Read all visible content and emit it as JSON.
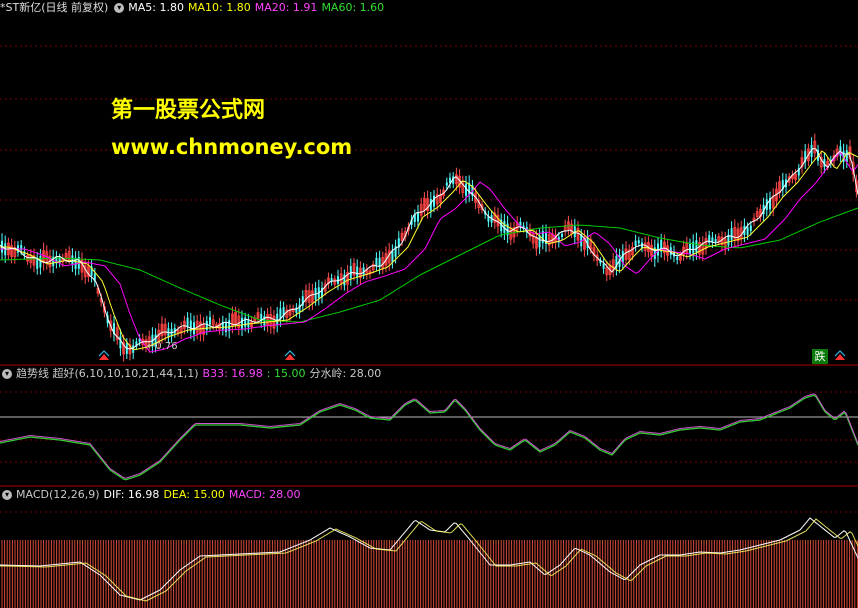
{
  "main_header": {
    "title": "*ST新亿(日线 前复权)",
    "ma5": "MA5: 1.80",
    "ma10": "MA10: 1.80",
    "ma20": "MA20: 1.91",
    "ma60": "MA60: 1.60"
  },
  "watermark": {
    "line1": "第一股票公式网",
    "line2": "www.chnmoney.com"
  },
  "low_price_label": "←0.76",
  "signal_badge": "跌",
  "trend_header": {
    "name": "趋势线 超好(6,10,10,10,21,44,1,1)",
    "b33": "B33: 16.98",
    "v2": ": 15.00",
    "fsl": "分水岭: 28.00"
  },
  "macd_header": {
    "name": "MACD(12,26,9)",
    "dif": "DIF: 16.98",
    "dea": "DEA: 15.00",
    "macd": "MACD: 28.00"
  },
  "colors": {
    "up": "#ff3b3b",
    "down": "#54ffff",
    "ma5": "#ffffff",
    "ma10": "#ffff00",
    "ma20": "#ff00ff",
    "ma60": "#00cc00",
    "grid": "#7a0000",
    "separator": "#b00000"
  }
}
